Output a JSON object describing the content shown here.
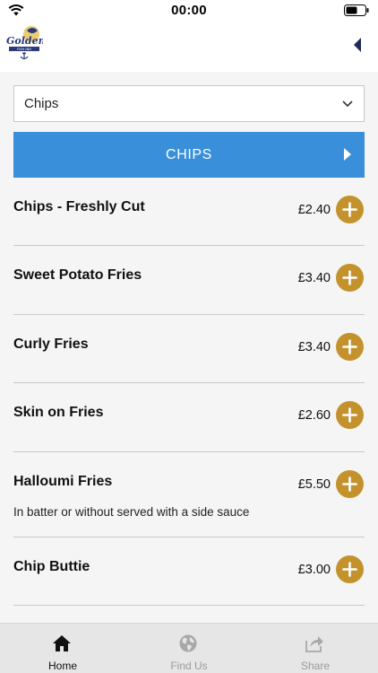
{
  "status_bar": {
    "time": "00:00"
  },
  "header": {
    "logo_text": "Golden",
    "logo_subtext": "FISH INN"
  },
  "category_select": {
    "value": "Chips"
  },
  "category_banner": {
    "title": "CHIPS"
  },
  "menu_items": [
    {
      "name": "Chips - Freshly Cut",
      "price": "£2.40",
      "description": ""
    },
    {
      "name": "Sweet Potato Fries",
      "price": "£3.40",
      "description": ""
    },
    {
      "name": "Curly Fries",
      "price": "£3.40",
      "description": ""
    },
    {
      "name": "Skin on Fries",
      "price": "£2.60",
      "description": ""
    },
    {
      "name": "Halloumi Fries",
      "price": "£5.50",
      "description": "In batter or without served with a side sauce"
    },
    {
      "name": "Chip Buttie",
      "price": "£3.00",
      "description": ""
    }
  ],
  "tabs": [
    {
      "label": "Home",
      "icon": "home-icon",
      "active": true
    },
    {
      "label": "Find Us",
      "icon": "globe-icon",
      "active": false
    },
    {
      "label": "Share",
      "icon": "share-icon",
      "active": false
    }
  ],
  "colors": {
    "banner": "#3a8fda",
    "add_button": "#c4922c",
    "back_arrow": "#1f2a5a"
  }
}
